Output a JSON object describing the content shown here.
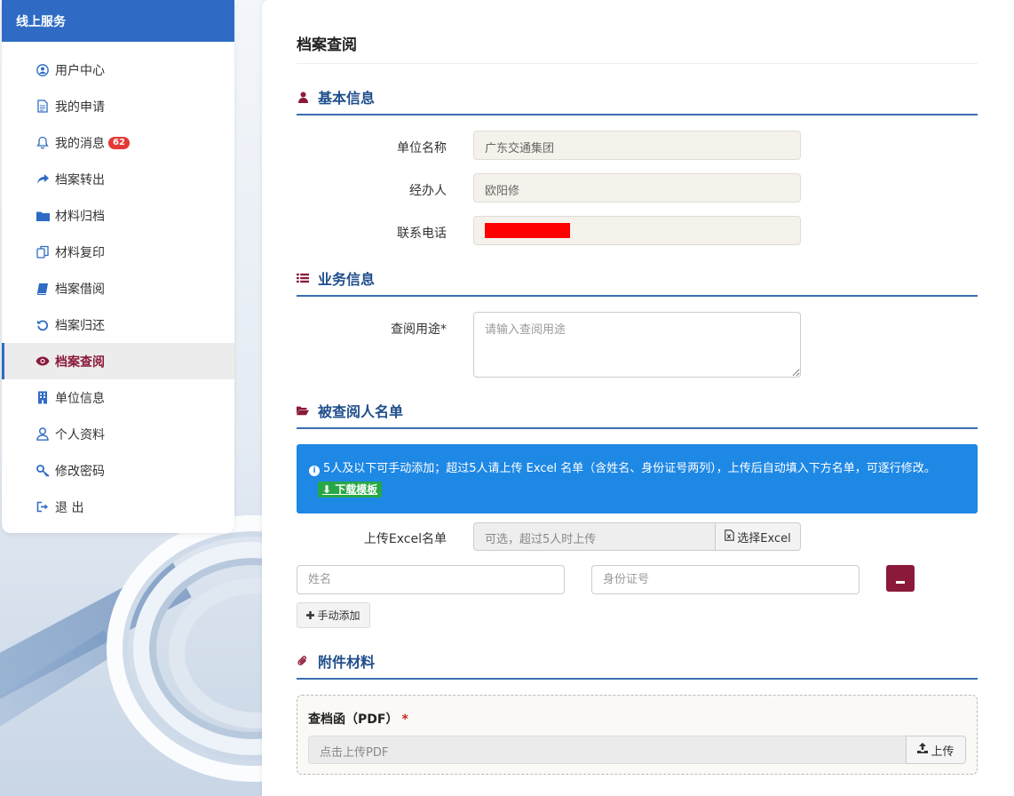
{
  "sidebar": {
    "title": "线上服务",
    "items": [
      {
        "label": "用户中心",
        "icon": "user-circle-icon"
      },
      {
        "label": "我的申请",
        "icon": "document-icon"
      },
      {
        "label": "我的消息",
        "icon": "bell-icon",
        "badge": "62"
      },
      {
        "label": "档案转出",
        "icon": "share-arrow-icon"
      },
      {
        "label": "材料归档",
        "icon": "folder-icon"
      },
      {
        "label": "材料复印",
        "icon": "copy-icon"
      },
      {
        "label": "档案借阅",
        "icon": "book-icon"
      },
      {
        "label": "档案归还",
        "icon": "undo-icon"
      },
      {
        "label": "档案查阅",
        "icon": "eye-icon",
        "active": true
      },
      {
        "label": "单位信息",
        "icon": "building-icon"
      },
      {
        "label": "个人资料",
        "icon": "person-icon"
      },
      {
        "label": "修改密码",
        "icon": "key-icon"
      },
      {
        "label": "退 出",
        "icon": "sign-out-icon"
      }
    ],
    "badge_color": "#e53935"
  },
  "main": {
    "page_title": "档案查阅",
    "sections": {
      "basic": "基本信息",
      "business": "业务信息",
      "persons": "被查阅人名单",
      "attachments": "附件材料"
    },
    "basic": {
      "unit_label": "单位名称",
      "unit_value": "广东交通集团",
      "handler_label": "经办人",
      "handler_value": "欧阳修",
      "phone_label": "联系电话"
    },
    "business": {
      "purpose_label": "查阅用途*",
      "purpose_placeholder": "请输入查阅用途"
    },
    "persons": {
      "info_text": "5人及以下可手动添加；超过5人请上传 Excel 名单（含姓名、身份证号两列），上传后自动填入下方名单，可逐行修改。",
      "download_label": "下载模板",
      "upload_label": "上传Excel名单",
      "upload_placeholder": "可选，超过5人时上传",
      "choose_excel_label": "选择Excel",
      "name_placeholder": "姓名",
      "id_placeholder": "身份证号",
      "add_label": "手动添加"
    },
    "attachments": {
      "letter_label": "查档函（PDF）",
      "required_mark": "*",
      "pdf_placeholder": "点击上传PDF",
      "upload_label": "上传"
    }
  },
  "colors": {
    "primary": "#2f6bc5",
    "accent": "#8b1a3a",
    "info": "#1e88e5",
    "success": "#28a745",
    "redaction": "#ff0000"
  }
}
